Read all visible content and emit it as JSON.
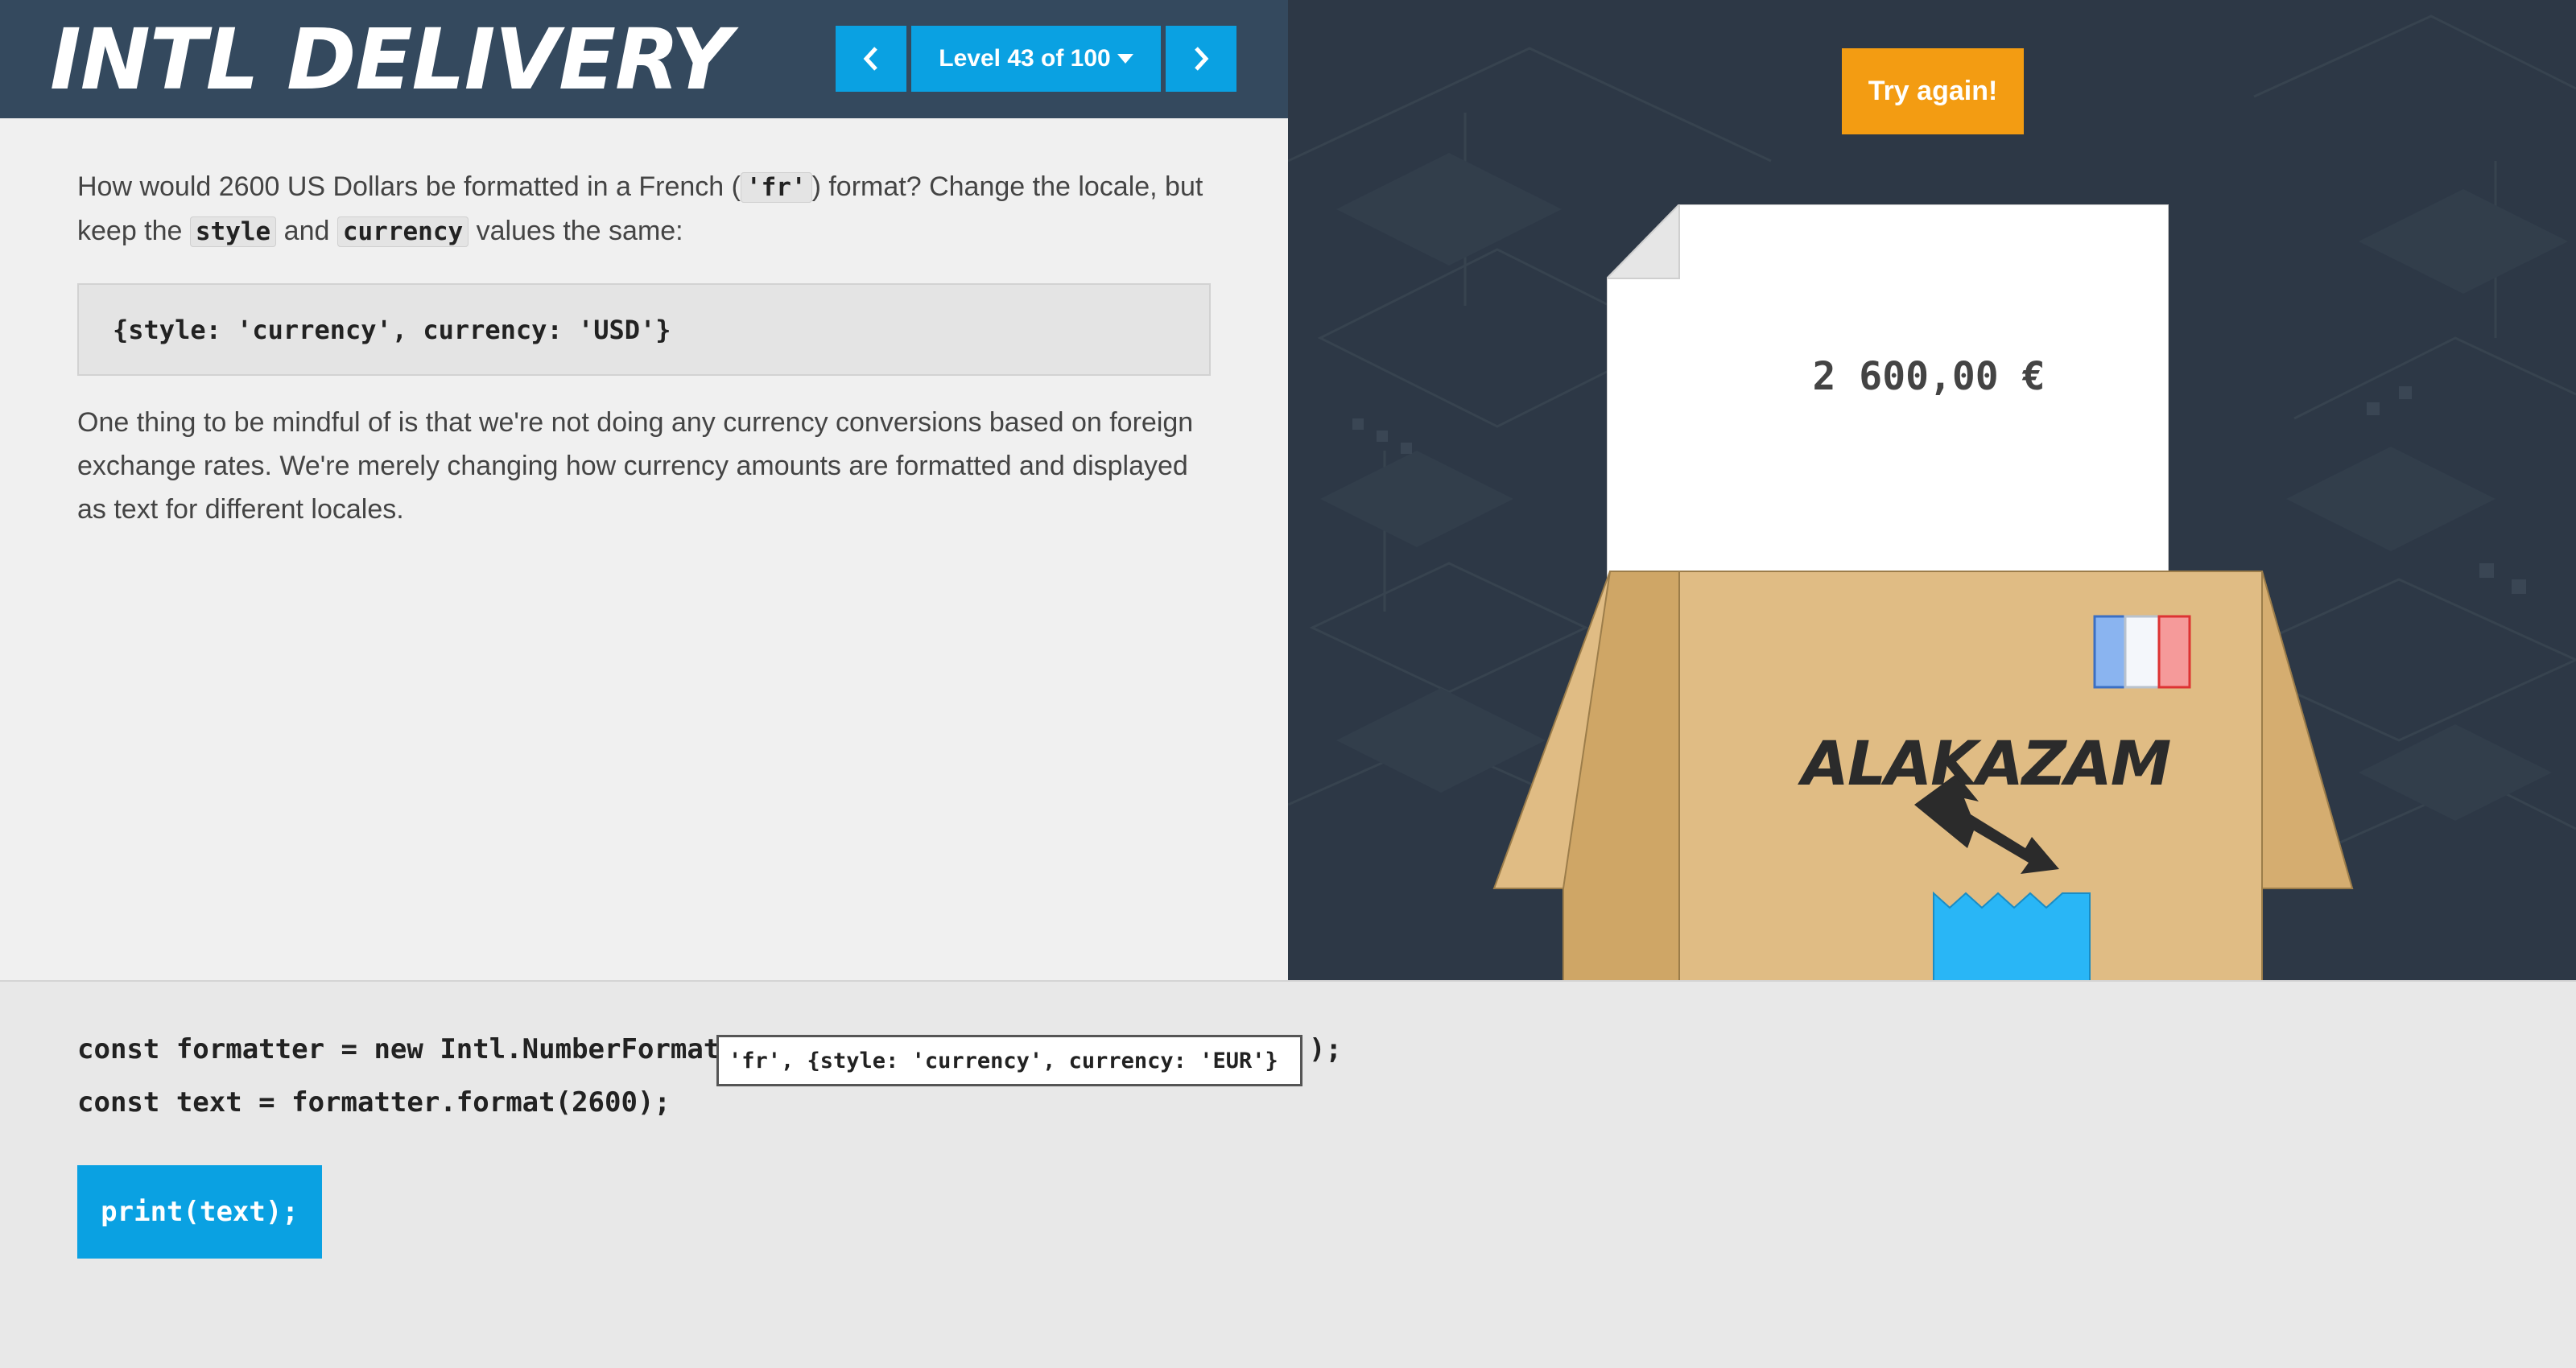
{
  "header": {
    "logo": "INTL DELIVERY",
    "level_label": "Level 43 of 100",
    "prev_icon": "chevron-left-icon",
    "next_icon": "chevron-right-icon",
    "dropdown_icon": "caret-down-icon"
  },
  "instructions": {
    "p1_a": "How would 2600 US Dollars be formatted in a French (",
    "p1_code_fr": "'fr'",
    "p1_b": ") format? Change the locale, but keep the ",
    "p1_code_style": "style",
    "p1_c": " and ",
    "p1_code_currency": "currency",
    "p1_d": " values the same:",
    "code_block": "{style: 'currency', currency: 'USD'}",
    "p2": "One thing to be mindful of is that we're not doing any currency conversions based on foreign exchange rates. We're merely changing how currency amounts are formatted and displayed as text for different locales."
  },
  "scene": {
    "try_again_label": "Try again!",
    "paper_text": "2 600,00 €",
    "box_brand": "ALAKAZAM",
    "flag": "french-flag",
    "colors": {
      "background": "#2d3846",
      "box": "#e0bc84",
      "box_shadow": "#cfa666",
      "tape": "#29b6f6",
      "flag_blue": "#8ab4f0",
      "flag_white": "#ffffff",
      "flag_red": "#f59a9a"
    }
  },
  "editor": {
    "line1_prefix": "const formatter = new Intl.NumberFormat(",
    "input_value": "'fr', {style: 'currency', currency: 'EUR'}",
    "line1_suffix": ");",
    "line2": "const text = formatter.format(2600);",
    "run_label": "print(text);"
  },
  "colors": {
    "accent": "#0aa1e2",
    "header_bg": "#34495e",
    "try_again": "#f39c12"
  }
}
